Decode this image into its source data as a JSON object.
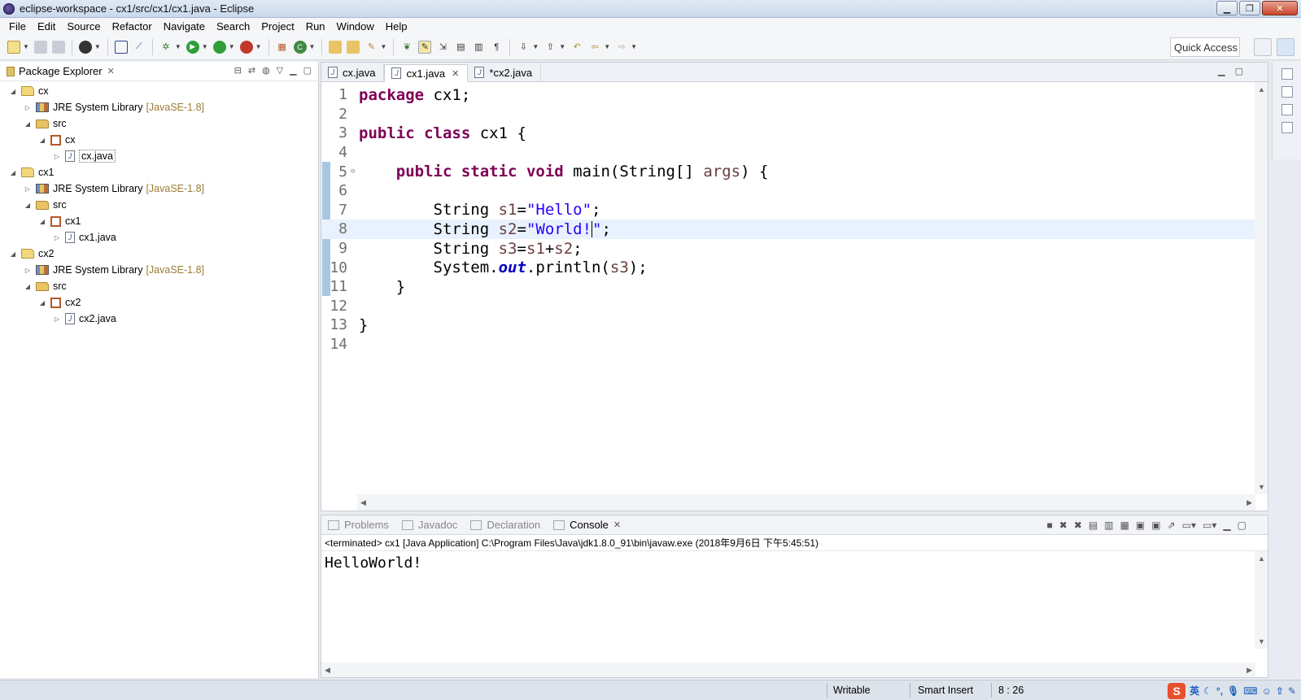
{
  "window": {
    "title": "eclipse-workspace - cx1/src/cx1/cx1.java - Eclipse"
  },
  "menu": [
    "File",
    "Edit",
    "Source",
    "Refactor",
    "Navigate",
    "Search",
    "Project",
    "Run",
    "Window",
    "Help"
  ],
  "toolbar": {
    "quick_access": "Quick Access"
  },
  "package_explorer": {
    "title": "Package Explorer",
    "tree": [
      {
        "label": "cx",
        "icon": "project-icon",
        "depth": 0,
        "expanded": true
      },
      {
        "label": "JRE System Library",
        "tag": "[JavaSE-1.8]",
        "icon": "library-icon",
        "depth": 1,
        "expanded": false
      },
      {
        "label": "src",
        "icon": "folder-icon",
        "depth": 1,
        "expanded": true
      },
      {
        "label": "cx",
        "icon": "package-icon",
        "depth": 2,
        "expanded": true
      },
      {
        "label": "cx.java",
        "icon": "java-file-icon",
        "depth": 3,
        "expanded": false,
        "selected": true
      },
      {
        "label": "cx1",
        "icon": "project-icon",
        "depth": 0,
        "expanded": true
      },
      {
        "label": "JRE System Library",
        "tag": "[JavaSE-1.8]",
        "icon": "library-icon",
        "depth": 1,
        "expanded": false
      },
      {
        "label": "src",
        "icon": "folder-icon",
        "depth": 1,
        "expanded": true
      },
      {
        "label": "cx1",
        "icon": "package-icon",
        "depth": 2,
        "expanded": true
      },
      {
        "label": "cx1.java",
        "icon": "java-file-icon",
        "depth": 3,
        "expanded": false
      },
      {
        "label": "cx2",
        "icon": "project-icon",
        "depth": 0,
        "expanded": true
      },
      {
        "label": "JRE System Library",
        "tag": "[JavaSE-1.8]",
        "icon": "library-icon",
        "depth": 1,
        "expanded": false
      },
      {
        "label": "src",
        "icon": "folder-icon",
        "depth": 1,
        "expanded": true
      },
      {
        "label": "cx2",
        "icon": "package-icon",
        "depth": 2,
        "expanded": true
      },
      {
        "label": "cx2.java",
        "icon": "java-file-icon",
        "depth": 3,
        "expanded": false
      }
    ]
  },
  "editor": {
    "tabs": [
      {
        "label": "cx.java",
        "active": false,
        "closable": false
      },
      {
        "label": "cx1.java",
        "active": true,
        "closable": true
      },
      {
        "label": "*cx2.java",
        "active": false,
        "closable": false
      }
    ],
    "current_line": 8,
    "lines": [
      [
        {
          "t": "package",
          "c": "kw"
        },
        {
          "t": " cx1;"
        }
      ],
      [],
      [
        {
          "t": "public",
          "c": "kw"
        },
        {
          "t": " "
        },
        {
          "t": "class",
          "c": "kw"
        },
        {
          "t": " cx1 {"
        }
      ],
      [],
      [
        {
          "t": "    "
        },
        {
          "t": "public",
          "c": "kw"
        },
        {
          "t": " "
        },
        {
          "t": "static",
          "c": "kw"
        },
        {
          "t": " "
        },
        {
          "t": "void",
          "c": "kw"
        },
        {
          "t": " main(String[] "
        },
        {
          "t": "args",
          "c": "var"
        },
        {
          "t": ") {"
        }
      ],
      [],
      [
        {
          "t": "        String "
        },
        {
          "t": "s1",
          "c": "var"
        },
        {
          "t": "="
        },
        {
          "t": "\"Hello\"",
          "c": "str"
        },
        {
          "t": ";"
        }
      ],
      [
        {
          "t": "        String "
        },
        {
          "t": "s2",
          "c": "var"
        },
        {
          "t": "="
        },
        {
          "t": "\"World!",
          "c": "str"
        },
        {
          "t": "",
          "caret": true
        },
        {
          "t": "\"",
          "c": "str"
        },
        {
          "t": ";"
        }
      ],
      [
        {
          "t": "        String "
        },
        {
          "t": "s3",
          "c": "var"
        },
        {
          "t": "="
        },
        {
          "t": "s1",
          "c": "var"
        },
        {
          "t": "+"
        },
        {
          "t": "s2",
          "c": "var"
        },
        {
          "t": ";"
        }
      ],
      [
        {
          "t": "        System."
        },
        {
          "t": "out",
          "c": "fld"
        },
        {
          "t": ".println("
        },
        {
          "t": "s3",
          "c": "var"
        },
        {
          "t": ");"
        }
      ],
      [
        {
          "t": "    }"
        }
      ],
      [],
      [
        {
          "t": "}"
        }
      ],
      []
    ]
  },
  "console": {
    "tabs": [
      {
        "label": "Problems",
        "active": false
      },
      {
        "label": "Javadoc",
        "active": false
      },
      {
        "label": "Declaration",
        "active": false
      },
      {
        "label": "Console",
        "active": true
      }
    ],
    "status": "<terminated> cx1 [Java Application] C:\\Program Files\\Java\\jdk1.8.0_91\\bin\\javaw.exe (2018年9月6日 下午5:45:51)",
    "output": "HelloWorld!"
  },
  "statusbar": {
    "writable": "Writable",
    "insert_mode": "Smart Insert",
    "position": "8 : 26",
    "ime_lang": "英"
  }
}
